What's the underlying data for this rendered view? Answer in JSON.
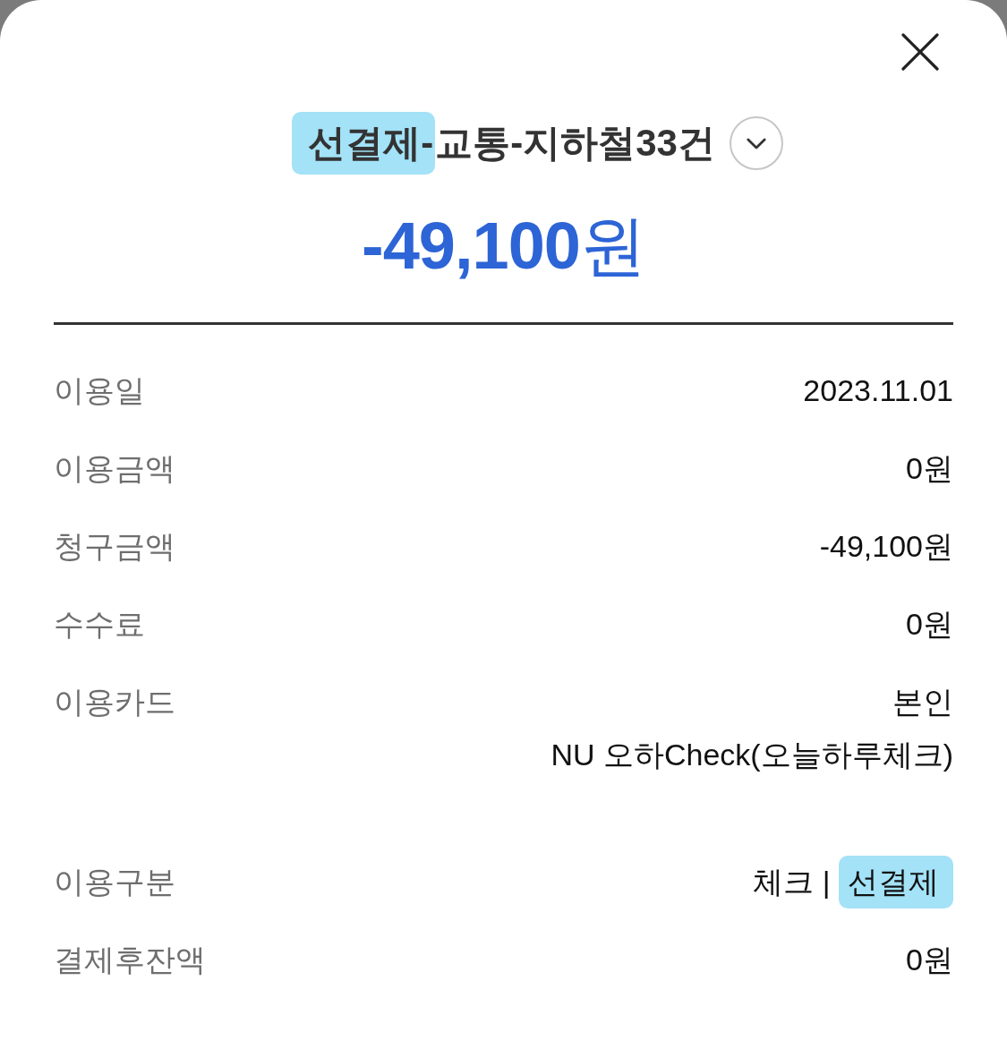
{
  "title": {
    "segments": [
      {
        "text": "선결제-",
        "highlighted": true
      },
      {
        "text": "교통-지하철33건",
        "highlighted": false
      }
    ],
    "expanded": false
  },
  "amount": "**-49,100**원",
  "sections": [
    {
      "rows": [
        {
          "label": "이용일",
          "lines": [
            [
              {
                "text": "2023.11.01",
                "highlighted": false
              }
            ]
          ]
        },
        {
          "label": "이용금액",
          "lines": [
            [
              {
                "text": "0원",
                "highlighted": false
              }
            ]
          ]
        },
        {
          "label": "청구금액",
          "lines": [
            [
              {
                "text": "-49,100원",
                "highlighted": false
              }
            ]
          ]
        },
        {
          "label": "수수료",
          "lines": [
            [
              {
                "text": "0원",
                "highlighted": false
              }
            ]
          ]
        },
        {
          "label": "이용카드",
          "lines": [
            [
              {
                "text": "본인",
                "highlighted": false
              }
            ],
            [
              {
                "text": "NU 오하Check(오늘하루체크)",
                "highlighted": false
              }
            ]
          ]
        }
      ]
    },
    {
      "rows": [
        {
          "label": "이용구분",
          "lines": [
            [
              {
                "text": "체크 | ",
                "highlighted": false
              },
              {
                "text": "선결제",
                "highlighted": true
              }
            ]
          ]
        },
        {
          "label": "결제후잔액",
          "lines": [
            [
              {
                "text": "0원",
                "highlighted": false
              }
            ]
          ]
        }
      ]
    }
  ]
}
